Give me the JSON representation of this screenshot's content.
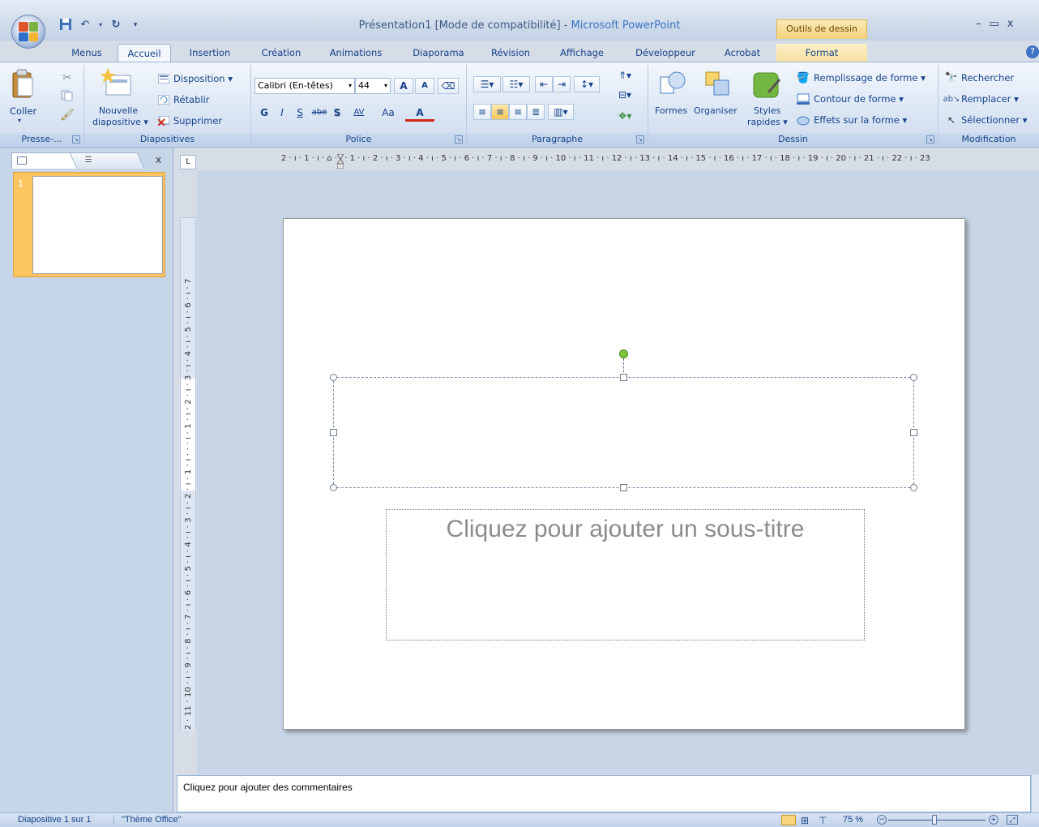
{
  "window": {
    "title": "Présentation1 [Mode de compatibilité]",
    "app": "Microsoft PowerPoint",
    "separator": " - ",
    "tools_tab": "Outils de dessin",
    "minimize": "–",
    "maximize": "▭",
    "close": "x"
  },
  "tabs": [
    "Menus",
    "Accueil",
    "Insertion",
    "Création",
    "Animations",
    "Diaporama",
    "Révision",
    "Affichage",
    "Développeur",
    "Acrobat",
    "Format"
  ],
  "help": "?",
  "ribbon": {
    "presse": {
      "coller": "Coller",
      "label": "Presse-..."
    },
    "diapositives": {
      "nouvelle1": "Nouvelle",
      "nouvelle2": "diapositive ▾",
      "disposition": "Disposition ▾",
      "retablir": "Rétablir",
      "supprimer": "Supprimer",
      "label": "Diapositives"
    },
    "police": {
      "font": "Calibri (En-têtes)",
      "size": "44",
      "grow": "A",
      "shrink": "A",
      "bold": "G",
      "italic": "I",
      "underline": "S",
      "strike": "abe",
      "shadow": "S",
      "spacing": "AV",
      "case": "Aa",
      "color": "A",
      "label": "Police"
    },
    "paragraphe": {
      "label": "Paragraphe"
    },
    "dessin": {
      "formes": "Formes",
      "organiser": "Organiser",
      "styles1": "Styles",
      "styles2": "rapides ▾",
      "remplissage": "Remplissage de forme ▾",
      "contour": "Contour de forme ▾",
      "effets": "Effets sur la forme ▾",
      "label": "Dessin"
    },
    "modification": {
      "rechercher": "Rechercher",
      "remplacer": "Remplacer ▾",
      "selectionner": "Sélectionner ▾",
      "label": "Modification"
    }
  },
  "left_pane": {
    "close": "x",
    "slide_number": "1"
  },
  "ruler_top": "2 · ı · 1 · ı · ⌂ · ı · 1 · ı · 2 · ı · 3 · ı · 4 · ı · 5 · ı · 6 · ı · 7 · ı · 8 · ı · 9 · ı · 10 · ı · 11 · ı · 12 · ı · 13 · ı · 14 · ı · 15 · ı · 16 · ı · 17 · ı · 18 · ı · 19 · ı · 20 · ı · 21 · ı · 22 · ı · 23",
  "ruler_left": "2 · 11 · 10 · ı · 9 · ı · 8 · ı · 7 · ı · 6 · ı · 5 · ı · 4 · ı · 3 · ı · 2 · ı · 1 · ı · · · ı · 1 · ı · 2 · ı · 3 · ı · 4 · ı · 5 · ı · 6 · ı · 7",
  "ruler_corner": "L",
  "slide": {
    "subtitle_placeholder": "Cliquez pour ajouter un sous-titre"
  },
  "notes": {
    "placeholder": "Cliquez pour ajouter des commentaires"
  },
  "status": {
    "slide": "Diapositive 1 sur 1",
    "theme": "\"Thème Office\"",
    "zoom": "75 %"
  }
}
